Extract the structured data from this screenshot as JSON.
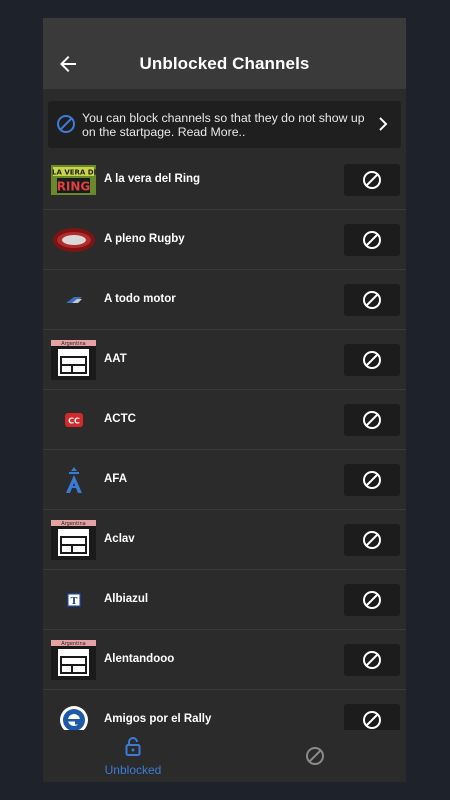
{
  "header": {
    "title": "Unblocked Channels",
    "back_icon": "arrow-left-icon"
  },
  "banner": {
    "text": "You can block channels so that they do not show up on the startpage. Read More..",
    "icon": "block-icon",
    "chevron_icon": "chevron-right-icon"
  },
  "channels": [
    {
      "name": "A la vera del Ring",
      "logo": "a-la-vera-del-ring-logo"
    },
    {
      "name": "A pleno Rugby",
      "logo": "a-pleno-rugby-logo"
    },
    {
      "name": "A todo motor",
      "logo": "a-todo-motor-logo"
    },
    {
      "name": "AAT",
      "logo": "argentina-calendar-logo",
      "logo_text": "Argentina"
    },
    {
      "name": "ACTC",
      "logo": "actc-logo",
      "logo_text": "CC"
    },
    {
      "name": "AFA",
      "logo": "afa-logo"
    },
    {
      "name": "Aclav",
      "logo": "argentina-calendar-logo",
      "logo_text": "Argentina"
    },
    {
      "name": "Albiazul",
      "logo": "albiazul-logo",
      "logo_text": "T"
    },
    {
      "name": "Alentandooo",
      "logo": "argentina-calendar-logo",
      "logo_text": "Argentina"
    },
    {
      "name": "Amigos por el Rally",
      "logo": "amigos-por-el-rally-logo"
    }
  ],
  "bottom_nav": {
    "unblocked_label": "Unblocked",
    "active": "unblocked",
    "active_color": "#3d7bd8"
  },
  "colors": {
    "background": "#1e222b",
    "app_bar": "#3a3a3a",
    "surface": "#2b2b2b",
    "button": "#1c1c1c"
  }
}
